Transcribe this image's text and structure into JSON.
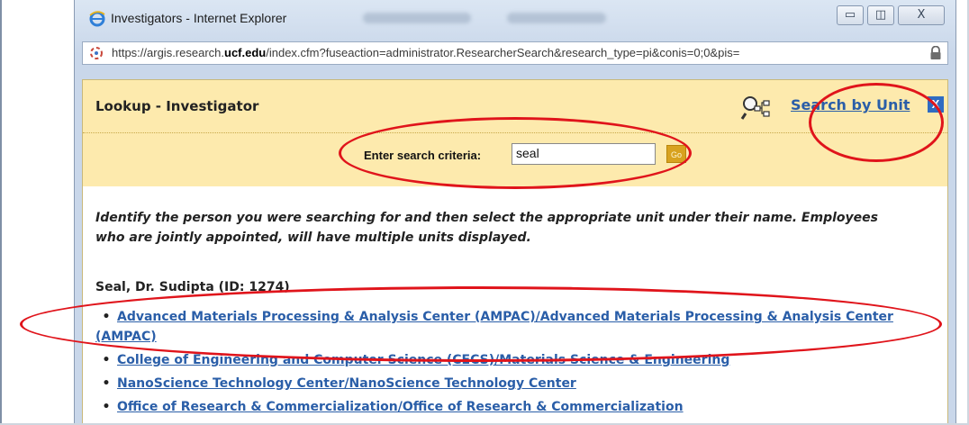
{
  "window": {
    "title": "Investigators - Internet Explorer",
    "controls": {
      "minimize": "▭",
      "maximize": "◫",
      "close": "X"
    }
  },
  "address_bar": {
    "url_prefix": "https://argis.research.",
    "url_domain": "ucf.edu",
    "url_suffix": "/index.cfm?fuseaction=administrator.ResearcherSearch&research_type=pi&conis=0;0&pis="
  },
  "lookup": {
    "title": "Lookup - Investigator",
    "search_by_unit_label": "Search by Unit",
    "close_label": "X",
    "criteria_label": "Enter search criteria:",
    "search_value": "seal",
    "go_label": "Go"
  },
  "results": {
    "instructions": "Identify the person you were searching for and then select the appropriate unit under their name. Employees who are jointly appointed, will have multiple units displayed.",
    "person": "Seal, Dr. Sudipta (ID: 1274)",
    "units": [
      "Advanced Materials Processing & Analysis Center (AMPAC)/Advanced Materials Processing & Analysis Center (AMPAC)",
      "College of Engineering and Computer Science (CECS)/Materials Science & Engineering",
      "NanoScience Technology Center/NanoScience Technology Center",
      "Office of Research & Commercialization/Office of Research & Commercialization"
    ]
  },
  "colors": {
    "header_bg": "#fdeaad",
    "link": "#2a5ea8",
    "annotation": "#e0141b"
  }
}
